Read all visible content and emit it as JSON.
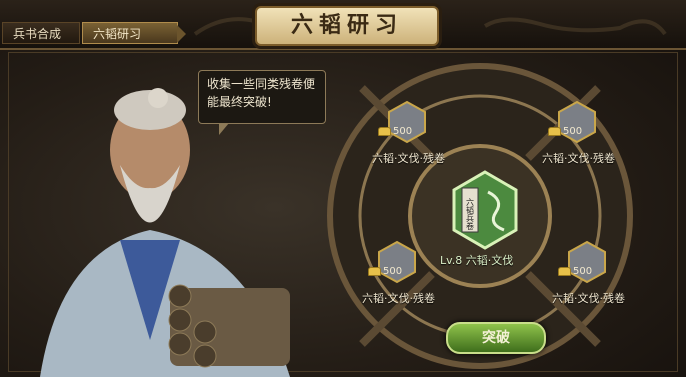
{
  "tabs": [
    {
      "label": "兵书合成"
    },
    {
      "label": "六韬研习"
    }
  ],
  "title": "六韬研习",
  "bubble_text": "收集一些同类残卷便能最终突破!",
  "slots": [
    {
      "cost": "500",
      "name": "六韬·文伐·残卷"
    },
    {
      "cost": "500",
      "name": "六韬·文伐·残卷"
    },
    {
      "cost": "500",
      "name": "六韬·文伐·残卷"
    },
    {
      "cost": "500",
      "name": "六韬·文伐·残卷"
    }
  ],
  "center": {
    "level": "Lv.8",
    "name": "六韬·文伐",
    "book_text": "六韬兵卷"
  },
  "button": {
    "label": "突破"
  },
  "colors": {
    "accent_green": "#7fb242",
    "gold": "#e8c14a",
    "panel_border": "#8d7a58"
  }
}
